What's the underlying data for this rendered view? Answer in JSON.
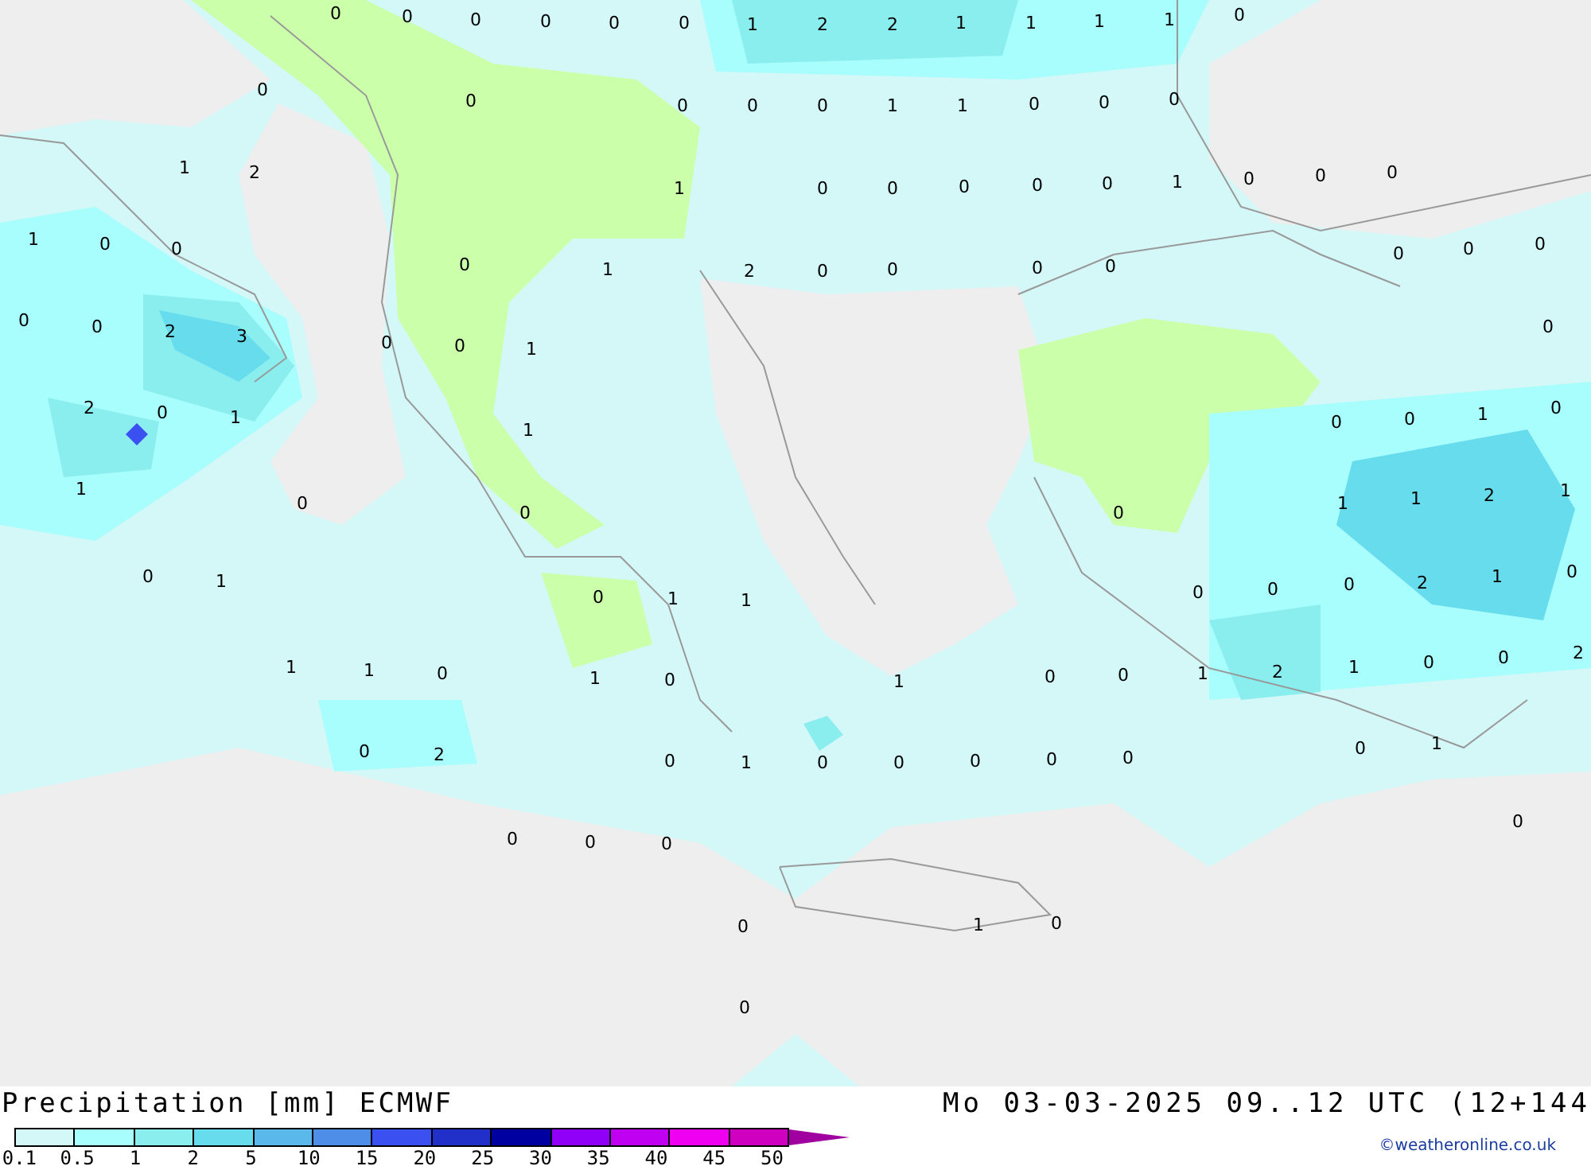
{
  "map": {
    "values": [
      "0",
      "0",
      "0",
      "0",
      "0",
      "0",
      "1",
      "2",
      "2",
      "1",
      "1",
      "1",
      "1",
      "0",
      "0",
      "0",
      "0",
      "0",
      "0",
      "1",
      "1",
      "0",
      "0",
      "0",
      "1",
      "2",
      "1",
      "0",
      "0",
      "0",
      "0",
      "0",
      "1",
      "0",
      "0",
      "0",
      "1",
      "0",
      "0",
      "0",
      "1",
      "2",
      "0",
      "0",
      "0",
      "0",
      "0",
      "0",
      "0",
      "0",
      "0",
      "2",
      "3",
      "0",
      "0",
      "1",
      "0",
      "2",
      "0",
      "1",
      "0",
      "0",
      "1",
      "0",
      "1",
      "1",
      "0",
      "0",
      "0",
      "1",
      "1",
      "2",
      "1",
      "0",
      "1",
      "0",
      "0",
      "0",
      "2",
      "1",
      "0",
      "0",
      "1",
      "1",
      "1",
      "1",
      "0",
      "1",
      "0",
      "1",
      "0",
      "0",
      "1",
      "2",
      "1",
      "0",
      "0",
      "2",
      "0",
      "2",
      "0",
      "1",
      "0",
      "0",
      "0",
      "0",
      "0",
      "0",
      "1",
      "0",
      "0",
      "0",
      "0",
      "0",
      "1",
      "0",
      "0"
    ]
  },
  "footer": {
    "title": "Precipitation [mm] ECMWF",
    "valid_time": "Mo 03-03-2025 09..12 UTC (12+144",
    "credit": "©weatheronline.co.uk",
    "legend": {
      "bins": [
        {
          "color": "#d4f7f7"
        },
        {
          "color": "#a8fdfd"
        },
        {
          "color": "#8beeee"
        },
        {
          "color": "#66dcec"
        },
        {
          "color": "#5ab8ea"
        },
        {
          "color": "#4f8ee8"
        },
        {
          "color": "#3a50f0"
        },
        {
          "color": "#2030c8"
        },
        {
          "color": "#0000a0"
        },
        {
          "color": "#9000f8"
        },
        {
          "color": "#c000f0"
        },
        {
          "color": "#f000f0"
        },
        {
          "color": "#d000c0"
        }
      ],
      "labels": [
        "0.1",
        "0.5",
        "1",
        "2",
        "5",
        "10",
        "15",
        "20",
        "25",
        "30",
        "35",
        "40",
        "45",
        "50"
      ]
    }
  }
}
